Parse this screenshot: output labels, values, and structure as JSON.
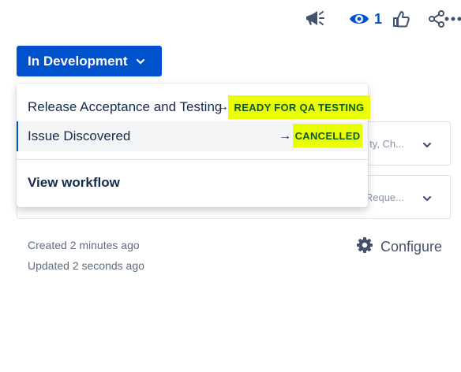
{
  "toolbar": {
    "feedback_icon": "megaphone-icon",
    "watch_icon": "eye-icon",
    "watch_count": "1",
    "like_icon": "thumbs-up-icon",
    "share_icon": "share-icon",
    "more_icon": "more-horizontal-icon"
  },
  "status": {
    "label": "In Development",
    "icon": "chevron-down-icon",
    "color": "#0052cc"
  },
  "background_fields": [
    {
      "truncated_text": "ty, Ch..."
    },
    {
      "truncated_text": "Reque..."
    }
  ],
  "meta": {
    "created": "Created 2 minutes ago",
    "updated": "Updated 2 seconds ago"
  },
  "configure": {
    "label": "Configure",
    "icon": "gear-icon"
  },
  "dropdown": {
    "transitions": [
      {
        "name": "Release Acceptance and Testing",
        "arrow": "→",
        "target_status": "READY FOR QA TESTING"
      },
      {
        "name": "Issue Discovered",
        "arrow": "→",
        "target_status": "CANCELLED"
      }
    ],
    "view_workflow": "View workflow",
    "highlight_color": "#eaff00"
  }
}
